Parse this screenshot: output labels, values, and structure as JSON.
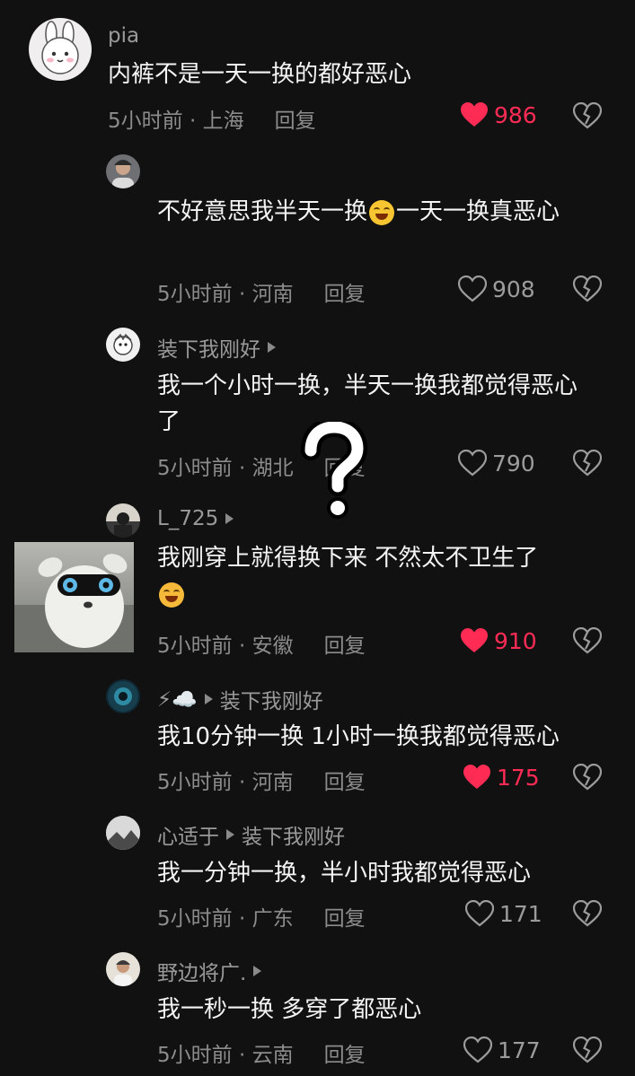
{
  "comments": [
    {
      "user": "pia",
      "reply_to": "",
      "text": "内裤不是一天一换的都好恶心",
      "time": "5小时前 · 上海",
      "reply": "回复",
      "likes": "986",
      "liked": true
    },
    {
      "user": "",
      "reply_to": "",
      "text": "不好意思我半天一换",
      "text2": "一天一换真恶心",
      "time": "5小时前 · 河南",
      "reply": "回复",
      "likes": "908",
      "liked": false
    },
    {
      "user": "装下我刚好",
      "reply_to": "",
      "text": "我一个小时一换，半天一换我都觉得恶心了",
      "time": "5小时前 · 湖北",
      "reply": "回复",
      "likes": "790",
      "liked": false
    },
    {
      "user": "L_725",
      "reply_to": "",
      "text": "我刚穿上就得换下来 不然太不卫生了",
      "time": "5小时前 · 安徽",
      "reply": "回复",
      "likes": "910",
      "liked": true
    },
    {
      "user": "⚡☁️",
      "reply_to": "装下我刚好",
      "text": "我10分钟一换 1小时一换我都觉得恶心",
      "time": "5小时前 · 河南",
      "reply": "回复",
      "likes": "175",
      "liked": true
    },
    {
      "user": "心适于",
      "reply_to": "装下我刚好",
      "text": "我一分钟一换，半小时我都觉得恶心",
      "time": "5小时前 · 广东",
      "reply": "回复",
      "likes": "171",
      "liked": false
    },
    {
      "user": "野边将广.",
      "reply_to": "",
      "text": "我一秒一换 多穿了都恶心",
      "time": "5小时前 · 云南",
      "reply": "回复",
      "likes": "177",
      "liked": false
    }
  ],
  "overlay": {
    "question_mark": "?"
  },
  "colors": {
    "background": "#111111",
    "liked": "#fe2c55",
    "muted": "#8c8c8c"
  },
  "icons": {
    "like": "heart-icon",
    "dislike": "broken-heart-icon",
    "reply_arrow": "play-triangle-icon"
  }
}
